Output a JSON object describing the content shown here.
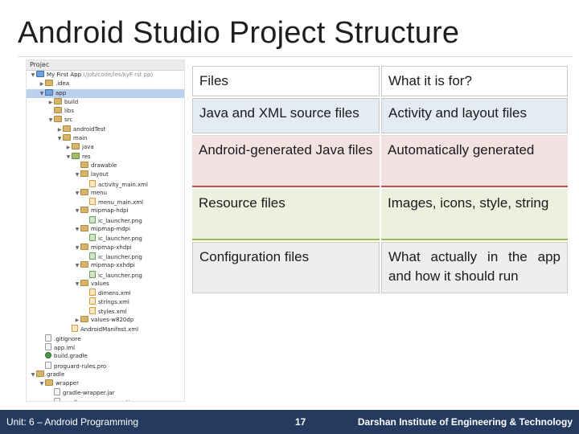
{
  "title": "Android Studio Project Structure",
  "tree": {
    "header": "Projec",
    "rows": [
      {
        "indent": 0,
        "arrow": "▼",
        "icon": "module",
        "label": "My First App",
        "hint": " (/job/code/les/kyF rst pp)",
        "selected": false
      },
      {
        "indent": 1,
        "arrow": "▶",
        "icon": "folder",
        "label": ".idea",
        "selected": false
      },
      {
        "indent": 1,
        "arrow": "▼",
        "icon": "module",
        "label": "app",
        "selected": true
      },
      {
        "indent": 2,
        "arrow": "▶",
        "icon": "folder",
        "label": "build",
        "selected": false
      },
      {
        "indent": 2,
        "arrow": "",
        "icon": "folder",
        "label": "libs",
        "selected": false
      },
      {
        "indent": 2,
        "arrow": "▼",
        "icon": "folder",
        "label": "src",
        "selected": false
      },
      {
        "indent": 3,
        "arrow": "▶",
        "icon": "folder",
        "label": "androidTest",
        "selected": false
      },
      {
        "indent": 3,
        "arrow": "▼",
        "icon": "folder",
        "label": "main",
        "selected": false
      },
      {
        "indent": 4,
        "arrow": "▶",
        "icon": "folder",
        "label": "java",
        "selected": false
      },
      {
        "indent": 4,
        "arrow": "▼",
        "icon": "res",
        "label": "res",
        "selected": false
      },
      {
        "indent": 5,
        "arrow": "",
        "icon": "folder",
        "label": "drawable",
        "selected": false
      },
      {
        "indent": 5,
        "arrow": "▼",
        "icon": "folder",
        "label": "layout",
        "selected": false
      },
      {
        "indent": 6,
        "arrow": "",
        "icon": "xml",
        "label": "activity_main.xml",
        "selected": false
      },
      {
        "indent": 5,
        "arrow": "▼",
        "icon": "folder",
        "label": "menu",
        "selected": false
      },
      {
        "indent": 6,
        "arrow": "",
        "icon": "xml",
        "label": "menu_main.xml",
        "selected": false
      },
      {
        "indent": 5,
        "arrow": "▼",
        "icon": "folder",
        "label": "mipmap-hdpi",
        "selected": false
      },
      {
        "indent": 6,
        "arrow": "",
        "icon": "png",
        "label": "ic_launcher.png",
        "selected": false
      },
      {
        "indent": 5,
        "arrow": "▼",
        "icon": "folder",
        "label": "mipmap-mdpi",
        "selected": false
      },
      {
        "indent": 6,
        "arrow": "",
        "icon": "png",
        "label": "ic_launcher.png",
        "selected": false
      },
      {
        "indent": 5,
        "arrow": "▼",
        "icon": "folder",
        "label": "mipmap-xhdpi",
        "selected": false
      },
      {
        "indent": 6,
        "arrow": "",
        "icon": "png",
        "label": "ic_launcher.png",
        "selected": false
      },
      {
        "indent": 5,
        "arrow": "▼",
        "icon": "folder",
        "label": "mipmap-xxhdpi",
        "selected": false
      },
      {
        "indent": 6,
        "arrow": "",
        "icon": "png",
        "label": "ic_launcher.png",
        "selected": false
      },
      {
        "indent": 5,
        "arrow": "▼",
        "icon": "folder",
        "label": "values",
        "selected": false
      },
      {
        "indent": 6,
        "arrow": "",
        "icon": "xml",
        "label": "dimens.xml",
        "selected": false
      },
      {
        "indent": 6,
        "arrow": "",
        "icon": "xml",
        "label": "strings.xml",
        "selected": false
      },
      {
        "indent": 6,
        "arrow": "",
        "icon": "xml",
        "label": "styles.xml",
        "selected": false
      },
      {
        "indent": 5,
        "arrow": "▶",
        "icon": "folder",
        "label": "values-w820dp",
        "selected": false
      },
      {
        "indent": 4,
        "arrow": "",
        "icon": "xml",
        "label": "AndroidManifest.xml",
        "selected": false
      },
      {
        "indent": 1,
        "arrow": "",
        "icon": "file",
        "label": ".gitignore",
        "selected": false
      },
      {
        "indent": 1,
        "arrow": "",
        "icon": "file",
        "label": "app.iml",
        "selected": false
      },
      {
        "indent": 1,
        "arrow": "",
        "icon": "gradle",
        "label": "build.gradle",
        "selected": false
      },
      {
        "indent": 1,
        "arrow": "",
        "icon": "file",
        "label": "proguard-rules.pro",
        "selected": false
      },
      {
        "indent": 0,
        "arrow": "▼",
        "icon": "folder",
        "label": "gradle",
        "selected": false
      },
      {
        "indent": 1,
        "arrow": "▼",
        "icon": "folder",
        "label": "wrapper",
        "selected": false
      },
      {
        "indent": 2,
        "arrow": "",
        "icon": "file",
        "label": "gradle-wrapper.jar",
        "selected": false
      },
      {
        "indent": 2,
        "arrow": "",
        "icon": "file",
        "label": "gradle-wrapper.properties",
        "selected": false
      }
    ]
  },
  "table": {
    "header": {
      "col1": "Files",
      "col2": "What it is for?"
    },
    "rows": [
      {
        "files": "Java and XML source files",
        "purpose": "Activity and layout files"
      },
      {
        "files": "Android-generated Java files",
        "purpose": "Automatically generated"
      },
      {
        "files": "Resource files",
        "purpose": "Images, icons, style, string"
      },
      {
        "files": "Configuration files",
        "purpose": "What actually in the app and how it should run"
      }
    ]
  },
  "footer": {
    "left": "Unit: 6 – Android Programming",
    "page": "17",
    "right": "Darshan Institute of Engineering & Technology"
  }
}
